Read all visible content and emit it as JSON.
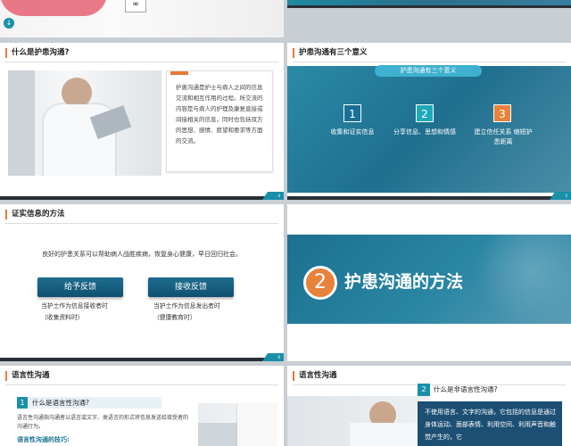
{
  "slide1": {
    "footer_num": ""
  },
  "slide2": {
    "footer_num": ""
  },
  "slide3": {
    "title": "什么是护患沟通?",
    "body": "护患沟通是护士与病人之间的信息交流和相互作用的过程。所交流的内容是与病人的护理及康复直接或间接相关的信息，同时也包括双方的思想、感情、愿望和要求等方面的交流。",
    "footer_num": "4"
  },
  "slide4": {
    "title": "护患沟通有三个意义",
    "banner": "护患沟通有三个意义",
    "items": [
      {
        "num": "1",
        "label": "收集和证实信息"
      },
      {
        "num": "2",
        "label": "分享信息、思想和情感"
      },
      {
        "num": "3",
        "label": "建立信任关系 缩短护患距离"
      }
    ],
    "colors": [
      "#1a6f95",
      "#1fa9b8",
      "#e8823a"
    ],
    "footer_num": "5"
  },
  "slide5": {
    "title": "证实信息的方法",
    "intro": "良好的护患关系可以帮助病人战胜疾病，恢复身心健康，早日回归社会。",
    "buttons": [
      {
        "label": "给予反馈",
        "line1": "当护士作为信息接收者时",
        "line2": "（收集资料时）"
      },
      {
        "label": "接收反馈",
        "line1": "当护士作为信息发出者时",
        "line2": "（健康教育时）"
      }
    ],
    "footer_num": "6"
  },
  "slide6": {
    "number": "2",
    "heading": "护患沟通的方法"
  },
  "slide7": {
    "title": "语言性沟通",
    "q_num": "1",
    "question": "什么是语言性沟通?",
    "body": "语言性沟通指沟通者以语言或文字、类语言的形式将信息发送给接受者的沟通行为。",
    "skill": "语言性沟通的技巧:"
  },
  "slide8": {
    "title": "语言性沟通",
    "q_num": "2",
    "question": "什么是非语言性沟通?",
    "body": "不使用语言、文字的沟通，它包括的信息是通过身体运动、面部表情、利用空间、利用声音和触觉产生的，它"
  }
}
